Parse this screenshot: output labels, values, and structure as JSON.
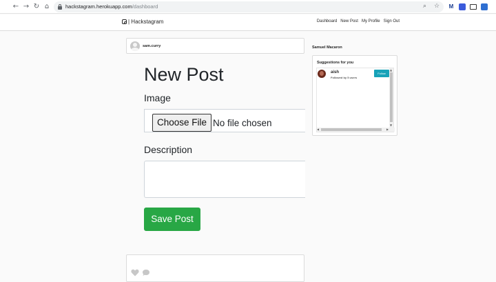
{
  "browser": {
    "url_host": "hackstagram.herokuapp.com",
    "url_path": "/dashboard",
    "icons": [
      "back-icon",
      "forward-icon",
      "reload-icon",
      "home-icon",
      "lock-icon",
      "search-icon",
      "star-icon"
    ],
    "ext_gmail": "M"
  },
  "navbar": {
    "brand": "| Hackstagram",
    "links": [
      "Dashboard",
      "New Post",
      "My Profile",
      "Sign Out"
    ]
  },
  "user_card": {
    "username": "sam.curry"
  },
  "form": {
    "title": "New Post",
    "image_label": "Image",
    "choose_file": "Choose File",
    "no_file": "No file chosen",
    "description_label": "Description",
    "save_label": "Save Post"
  },
  "sidebar": {
    "current_user": "Samuel Macaron",
    "suggestions_title": "Suggestions for you",
    "suggestions": [
      {
        "username": "aish",
        "subtitle": "Followed by 5 users",
        "follow_label": "Follow"
      }
    ]
  },
  "colors": {
    "save": "#28a745",
    "follow": "#17a2b8"
  }
}
